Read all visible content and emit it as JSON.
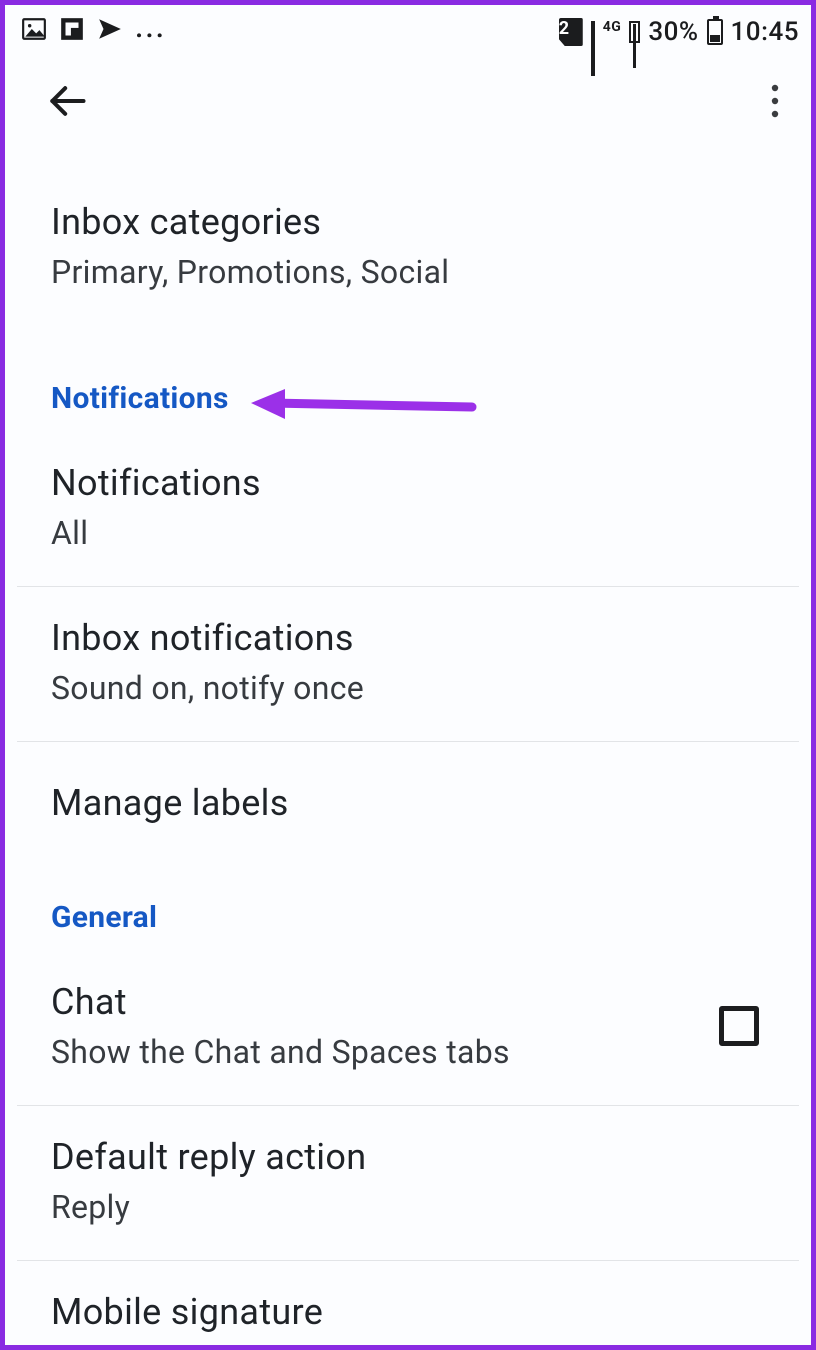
{
  "status_bar": {
    "sim_badge": "2",
    "network_label": "4G",
    "battery_percent": "30%",
    "time": "10:45",
    "overflow": "..."
  },
  "sections": {
    "inbox_categories": {
      "title": "Inbox categories",
      "subtitle": "Primary, Promotions, Social"
    },
    "notifications_header": "Notifications",
    "notifications": {
      "title": "Notifications",
      "subtitle": "All"
    },
    "inbox_notifications": {
      "title": "Inbox notifications",
      "subtitle": "Sound on, notify once"
    },
    "manage_labels": {
      "title": "Manage labels"
    },
    "general_header": "General",
    "chat": {
      "title": "Chat",
      "subtitle": "Show the Chat and Spaces tabs",
      "checked": false
    },
    "default_reply": {
      "title": "Default reply action",
      "subtitle": "Reply"
    },
    "mobile_signature": {
      "title": "Mobile signature"
    }
  },
  "annotation": {
    "arrow_color": "#9b30e8"
  }
}
